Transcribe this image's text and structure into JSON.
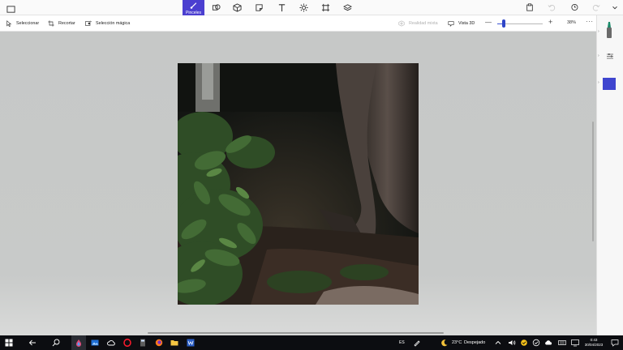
{
  "ribbon": {
    "active_tool_label": "Pinceles",
    "tools": [
      "brushes-icon",
      "2d-shapes-icon",
      "3d-shapes-icon",
      "stickers-icon",
      "text-icon",
      "effects-icon",
      "canvas-icon",
      "library-icon"
    ],
    "right_tools": [
      "paste-icon",
      "undo-icon",
      "history-icon",
      "redo-icon",
      "expand-icon"
    ]
  },
  "toolbar": {
    "select_label": "Seleccionar",
    "crop_label": "Recortar",
    "magic_select_label": "Selección mágica",
    "mixed_reality_label": "Realidad mixta",
    "view3d_label": "Vista 3D",
    "zoom_minus": "—",
    "zoom_plus": "+",
    "zoom_value": "38%",
    "more_label": "···"
  },
  "zoom": {
    "level_fraction": 0.15
  },
  "colors": {
    "accent": "#4b3fd0",
    "selected_color": "#3f45cf",
    "marker_tip": "#1a8a6a"
  },
  "taskbar": {
    "language": "ES",
    "weather_temp": "23°C",
    "weather_desc": "Despejado",
    "time": "0:43",
    "date": "30/04/2023"
  }
}
